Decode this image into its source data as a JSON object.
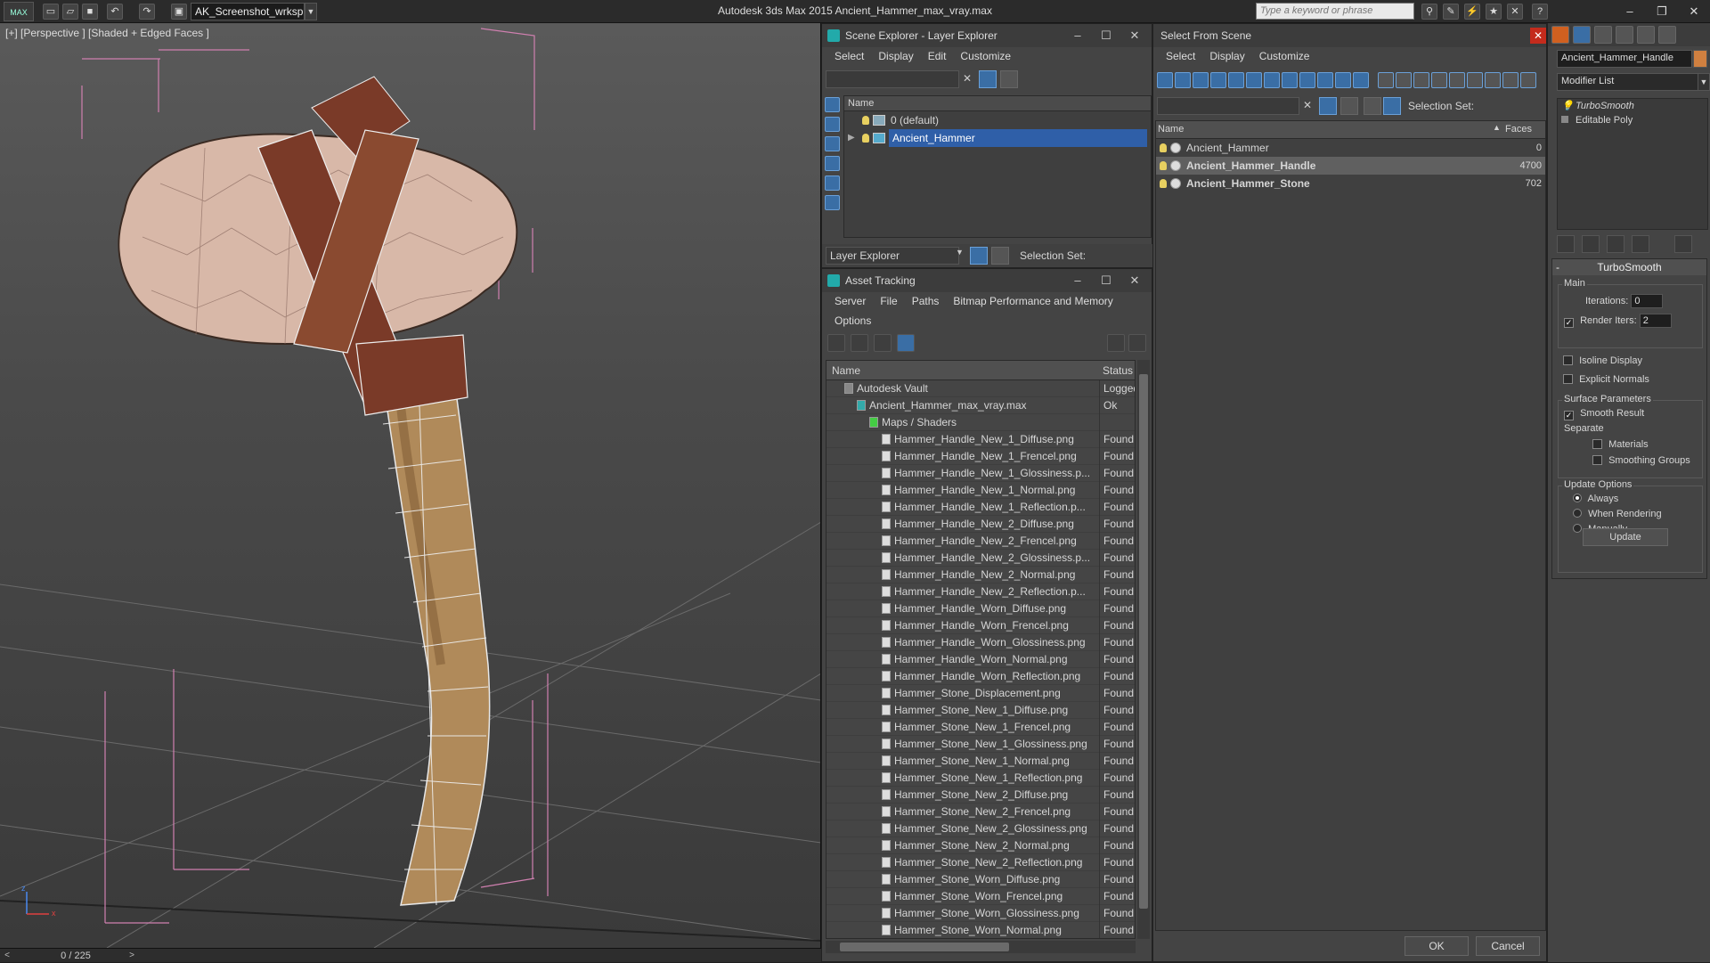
{
  "app": {
    "workspace": "AK_Screenshot_wrksp",
    "title": "Autodesk 3ds Max  2015    Ancient_Hammer_max_vray.max",
    "search_placeholder": "Type a keyword or phrase",
    "logo": "MAX"
  },
  "viewport": {
    "label": "[+] [Perspective ] [Shaded + Edged Faces ]",
    "timeline": "0 / 225",
    "timeline_prev": "<",
    "timeline_next": ">",
    "axis_z": "z",
    "axis_x": "x"
  },
  "scene_explorer": {
    "title": "Scene Explorer - Layer Explorer",
    "menu": [
      "Select",
      "Display",
      "Edit",
      "Customize"
    ],
    "column": "Name",
    "layers": [
      {
        "name": "0 (default)",
        "selected": false
      },
      {
        "name": "Ancient_Hammer",
        "selected": true
      }
    ],
    "explorer_dropdown": "Layer Explorer",
    "selection_set_label": "Selection Set:"
  },
  "asset_tracking": {
    "title": "Asset Tracking",
    "menu": [
      "Server",
      "File",
      "Paths",
      "Bitmap Performance and Memory"
    ],
    "menu2": [
      "Options"
    ],
    "col_name": "Name",
    "col_status": "Status",
    "rows": [
      {
        "name": "Autodesk Vault",
        "status": "Logged",
        "level": 0
      },
      {
        "name": "Ancient_Hammer_max_vray.max",
        "status": "Ok",
        "level": 1
      },
      {
        "name": "Maps / Shaders",
        "status": "",
        "level": 2
      },
      {
        "name": "Hammer_Handle_New_1_Diffuse.png",
        "status": "Found",
        "level": 3
      },
      {
        "name": "Hammer_Handle_New_1_Frencel.png",
        "status": "Found",
        "level": 3
      },
      {
        "name": "Hammer_Handle_New_1_Glossiness.p...",
        "status": "Found",
        "level": 3
      },
      {
        "name": "Hammer_Handle_New_1_Normal.png",
        "status": "Found",
        "level": 3
      },
      {
        "name": "Hammer_Handle_New_1_Reflection.p...",
        "status": "Found",
        "level": 3
      },
      {
        "name": "Hammer_Handle_New_2_Diffuse.png",
        "status": "Found",
        "level": 3
      },
      {
        "name": "Hammer_Handle_New_2_Frencel.png",
        "status": "Found",
        "level": 3
      },
      {
        "name": "Hammer_Handle_New_2_Glossiness.p...",
        "status": "Found",
        "level": 3
      },
      {
        "name": "Hammer_Handle_New_2_Normal.png",
        "status": "Found",
        "level": 3
      },
      {
        "name": "Hammer_Handle_New_2_Reflection.p...",
        "status": "Found",
        "level": 3
      },
      {
        "name": "Hammer_Handle_Worn_Diffuse.png",
        "status": "Found",
        "level": 3
      },
      {
        "name": "Hammer_Handle_Worn_Frencel.png",
        "status": "Found",
        "level": 3
      },
      {
        "name": "Hammer_Handle_Worn_Glossiness.png",
        "status": "Found",
        "level": 3
      },
      {
        "name": "Hammer_Handle_Worn_Normal.png",
        "status": "Found",
        "level": 3
      },
      {
        "name": "Hammer_Handle_Worn_Reflection.png",
        "status": "Found",
        "level": 3
      },
      {
        "name": "Hammer_Stone_Displacement.png",
        "status": "Found",
        "level": 3
      },
      {
        "name": "Hammer_Stone_New_1_Diffuse.png",
        "status": "Found",
        "level": 3
      },
      {
        "name": "Hammer_Stone_New_1_Frencel.png",
        "status": "Found",
        "level": 3
      },
      {
        "name": "Hammer_Stone_New_1_Glossiness.png",
        "status": "Found",
        "level": 3
      },
      {
        "name": "Hammer_Stone_New_1_Normal.png",
        "status": "Found",
        "level": 3
      },
      {
        "name": "Hammer_Stone_New_1_Reflection.png",
        "status": "Found",
        "level": 3
      },
      {
        "name": "Hammer_Stone_New_2_Diffuse.png",
        "status": "Found",
        "level": 3
      },
      {
        "name": "Hammer_Stone_New_2_Frencel.png",
        "status": "Found",
        "level": 3
      },
      {
        "name": "Hammer_Stone_New_2_Glossiness.png",
        "status": "Found",
        "level": 3
      },
      {
        "name": "Hammer_Stone_New_2_Normal.png",
        "status": "Found",
        "level": 3
      },
      {
        "name": "Hammer_Stone_New_2_Reflection.png",
        "status": "Found",
        "level": 3
      },
      {
        "name": "Hammer_Stone_Worn_Diffuse.png",
        "status": "Found",
        "level": 3
      },
      {
        "name": "Hammer_Stone_Worn_Frencel.png",
        "status": "Found",
        "level": 3
      },
      {
        "name": "Hammer_Stone_Worn_Glossiness.png",
        "status": "Found",
        "level": 3
      },
      {
        "name": "Hammer_Stone_Worn_Normal.png",
        "status": "Found",
        "level": 3
      }
    ]
  },
  "select_from_scene": {
    "title": "Select From Scene",
    "menu": [
      "Select",
      "Display",
      "Customize"
    ],
    "selection_set_label": "Selection Set:",
    "col_name": "Name",
    "col_faces": "Faces",
    "objects": [
      {
        "name": "Ancient_Hammer",
        "faces": "0",
        "selected": false,
        "bold": false
      },
      {
        "name": "Ancient_Hammer_Handle",
        "faces": "4700",
        "selected": true,
        "bold": true
      },
      {
        "name": "Ancient_Hammer_Stone",
        "faces": "702",
        "selected": false,
        "bold": true
      }
    ],
    "ok_label": "OK",
    "cancel_label": "Cancel"
  },
  "command_panel": {
    "object_name": "Ancient_Hammer_Handle",
    "object_color": "#d08040",
    "modifier_list": "Modifier List",
    "stack": [
      "TurboSmooth",
      "Editable Poly"
    ],
    "rollout_title": "TurboSmooth",
    "main_group": "Main",
    "iterations_label": "Iterations:",
    "iterations_value": "0",
    "render_iters_label": "Render Iters:",
    "render_iters_value": "2",
    "render_iters_checked": true,
    "isoline_label": "Isoline Display",
    "explicit_normals_label": "Explicit Normals",
    "surface_group": "Surface Parameters",
    "smooth_result_label": "Smooth Result",
    "smooth_result_checked": true,
    "separate_label": "Separate",
    "materials_label": "Materials",
    "smoothing_groups_label": "Smoothing Groups",
    "update_group": "Update Options",
    "always_label": "Always",
    "when_rendering_label": "When Rendering",
    "manually_label": "Manually",
    "update_button": "Update"
  }
}
